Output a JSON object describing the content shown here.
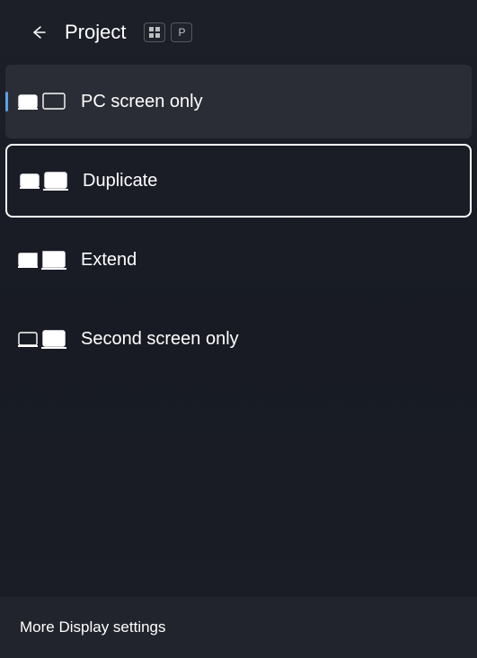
{
  "header": {
    "title": "Project",
    "shortcut_keys": [
      "Win",
      "P"
    ]
  },
  "options": [
    {
      "label": "PC screen only",
      "selected": true,
      "focused": false
    },
    {
      "label": "Duplicate",
      "selected": false,
      "focused": true
    },
    {
      "label": "Extend",
      "selected": false,
      "focused": false
    },
    {
      "label": "Second screen only",
      "selected": false,
      "focused": false
    }
  ],
  "footer": {
    "link_label": "More Display settings"
  }
}
